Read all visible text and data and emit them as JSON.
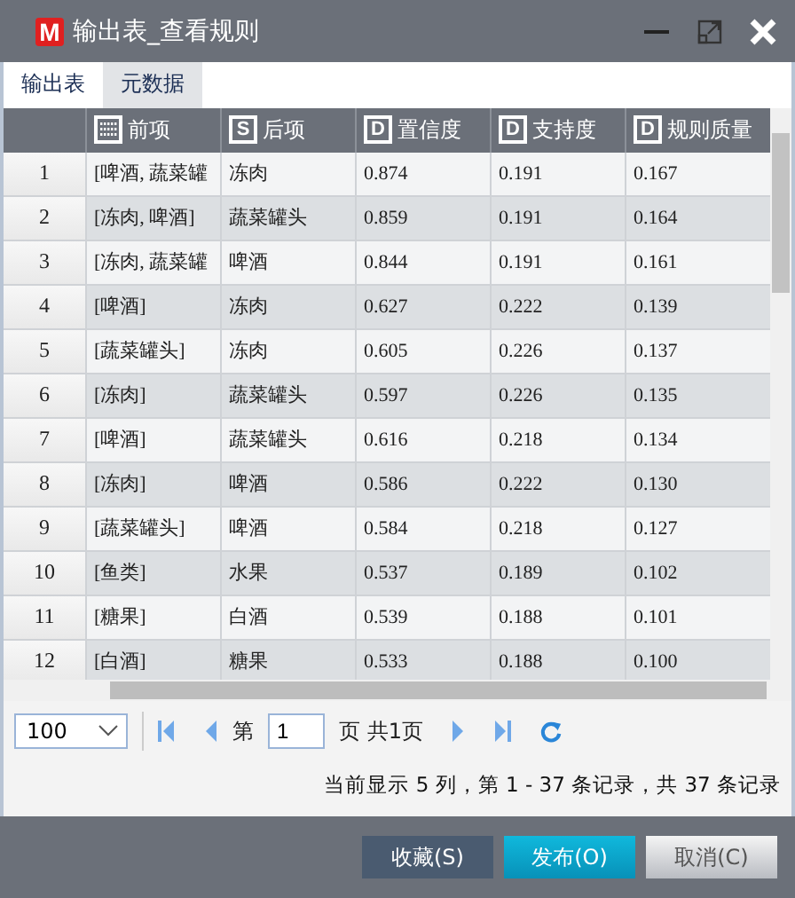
{
  "window": {
    "title": "输出表_查看规则",
    "logo_letter": "M"
  },
  "tabs": [
    {
      "label": "输出表",
      "selected": true
    },
    {
      "label": "元数据",
      "selected": false
    }
  ],
  "table": {
    "columns": [
      {
        "label": "前项",
        "kind": "grid"
      },
      {
        "label": "后项",
        "kind": "letter",
        "letter": "S"
      },
      {
        "label": "置信度",
        "kind": "letter",
        "letter": "D"
      },
      {
        "label": "支持度",
        "kind": "letter",
        "letter": "D"
      },
      {
        "label": "规则质量",
        "kind": "letter",
        "letter": "D"
      }
    ],
    "rows": [
      {
        "index": "1",
        "cells": [
          "[啤酒, 蔬菜罐",
          "冻肉",
          "0.874",
          "0.191",
          "0.167"
        ]
      },
      {
        "index": "2",
        "cells": [
          "[冻肉, 啤酒]",
          "蔬菜罐头",
          "0.859",
          "0.191",
          "0.164"
        ]
      },
      {
        "index": "3",
        "cells": [
          "[冻肉, 蔬菜罐",
          "啤酒",
          "0.844",
          "0.191",
          "0.161"
        ]
      },
      {
        "index": "4",
        "cells": [
          "[啤酒]",
          "冻肉",
          "0.627",
          "0.222",
          "0.139"
        ]
      },
      {
        "index": "5",
        "cells": [
          "[蔬菜罐头]",
          "冻肉",
          "0.605",
          "0.226",
          "0.137"
        ]
      },
      {
        "index": "6",
        "cells": [
          "[冻肉]",
          "蔬菜罐头",
          "0.597",
          "0.226",
          "0.135"
        ]
      },
      {
        "index": "7",
        "cells": [
          "[啤酒]",
          "蔬菜罐头",
          "0.616",
          "0.218",
          "0.134"
        ]
      },
      {
        "index": "8",
        "cells": [
          "[冻肉]",
          "啤酒",
          "0.586",
          "0.222",
          "0.130"
        ]
      },
      {
        "index": "9",
        "cells": [
          "[蔬菜罐头]",
          "啤酒",
          "0.584",
          "0.218",
          "0.127"
        ]
      },
      {
        "index": "10",
        "cells": [
          "[鱼类]",
          "水果",
          "0.537",
          "0.189",
          "0.102"
        ]
      },
      {
        "index": "11",
        "cells": [
          "[糖果]",
          "白酒",
          "0.539",
          "0.188",
          "0.101"
        ]
      },
      {
        "index": "12",
        "cells": [
          "[白酒]",
          "糖果",
          "0.533",
          "0.188",
          "0.100"
        ]
      }
    ]
  },
  "pager": {
    "page_size": "100",
    "page_prefix": "第",
    "page": "1",
    "page_suffix": "页 共1页"
  },
  "status": "当前显示 5 列，第 1 - 37 条记录，共 37 条记录",
  "buttons": [
    {
      "label": "收藏(S)",
      "kind": "dark"
    },
    {
      "label": "发布(O)",
      "kind": "primary"
    },
    {
      "label": "取消(C)",
      "kind": "light"
    }
  ]
}
